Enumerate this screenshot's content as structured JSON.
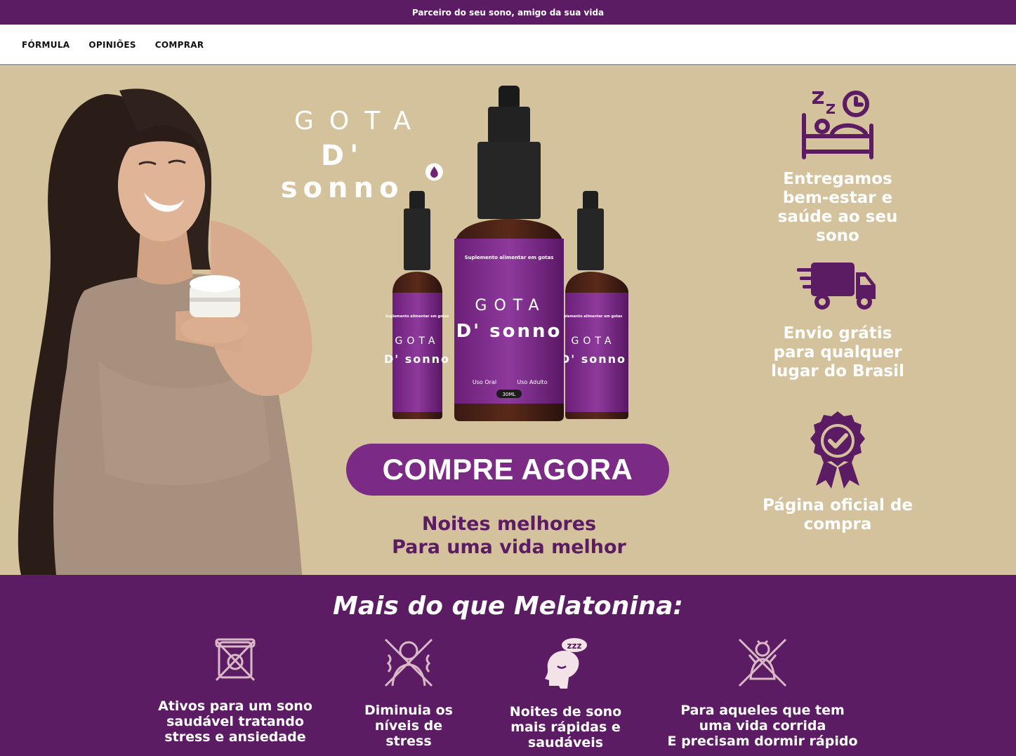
{
  "announcement": {
    "text": "Parceiro do seu sono, amigo da sua vida"
  },
  "nav": {
    "items": [
      {
        "label": "FÓRMULA"
      },
      {
        "label": "OPINIÕES"
      },
      {
        "label": "COMPRAR"
      }
    ]
  },
  "hero": {
    "brand_top": "GOTA",
    "brand_bottom": "D' sonno",
    "bottle": {
      "label_small": "Suplemento alimentar em gotas",
      "brand_top": "GOTA",
      "brand_bottom": "D' sonno",
      "use_oral": "Uso Oral",
      "use_adult": "Uso Adulto",
      "volume": "30ML"
    },
    "cta_label": "COMPRE AGORA",
    "tagline_line1": "Noites melhores",
    "tagline_line2": "Para uma vida melhor"
  },
  "benefits": [
    {
      "icon": "sleep-bed-icon",
      "text": "Entregamos bem-estar e saúde ao seu sono"
    },
    {
      "icon": "delivery-truck-icon",
      "text": "Envio grátis para qualquer lugar do Brasil"
    },
    {
      "icon": "official-badge-icon",
      "text": "Página oficial de compra"
    }
  ],
  "features": {
    "title": "Mais do que Melatonina:",
    "items": [
      {
        "icon": "no-pills-icon",
        "text": "Ativos para um sono\nsaudável tratando\nstress e ansiedade"
      },
      {
        "icon": "no-stress-icon",
        "text": "Diminuia os\nníveis de\nstress"
      },
      {
        "icon": "sleeping-head-icon",
        "text": "Noites de sono\nmais rápidas e\nsaudáveis"
      },
      {
        "icon": "no-rush-icon",
        "text": "Para aqueles que tem\numa vida corrida\nE precisam dormir rápido"
      }
    ]
  },
  "colors": {
    "brand_purple": "#5c1c63",
    "cta_purple": "#7b2a85",
    "hero_beige": "#d3c29b"
  }
}
